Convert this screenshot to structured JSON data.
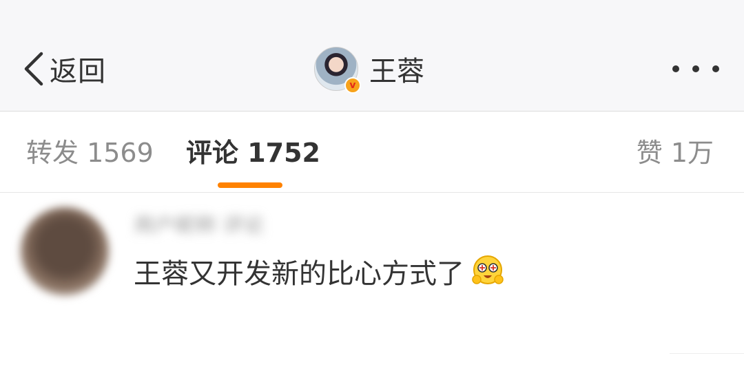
{
  "navbar": {
    "back_label": "返回",
    "back_icon": "chevron-left-icon",
    "profile_name": "王蓉",
    "verified_badge": "v",
    "more_icon": "more-dots-icon"
  },
  "tabs": {
    "repost_label": "转发 1569",
    "comment_label": "评论 1752",
    "like_label": "赞 1万",
    "active": "comment",
    "indicator_color": "#ff8200"
  },
  "comment": {
    "username": "用户昵称 评论",
    "text": "王蓉又开发新的比心方式了",
    "emoji": "happy-heart-hands-emoji"
  },
  "colors": {
    "accent": "#ff8200",
    "text_primary": "#333333",
    "text_secondary": "#8c8c8c",
    "navbar_bg": "#f7f7f9"
  }
}
